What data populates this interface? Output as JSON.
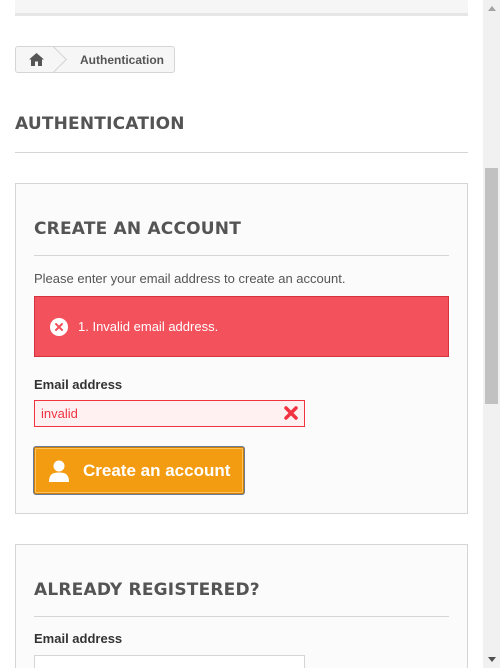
{
  "breadcrumb": {
    "home_icon": "home-icon",
    "current": "Authentication"
  },
  "page": {
    "heading": "AUTHENTICATION"
  },
  "create_account": {
    "title": "CREATE AN ACCOUNT",
    "intro": "Please enter your email address to create an account.",
    "error": {
      "message": "1. Invalid email address.",
      "icon": "error-circle-icon"
    },
    "email_label": "Email address",
    "email_value": "invalid",
    "button_label": "Create an account",
    "button_icon": "user-icon"
  },
  "login": {
    "title": "ALREADY REGISTERED?",
    "email_label": "Email address",
    "email_value": ""
  },
  "colors": {
    "accent": "#f39c11",
    "error": "#f3515c",
    "text": "#555454"
  }
}
